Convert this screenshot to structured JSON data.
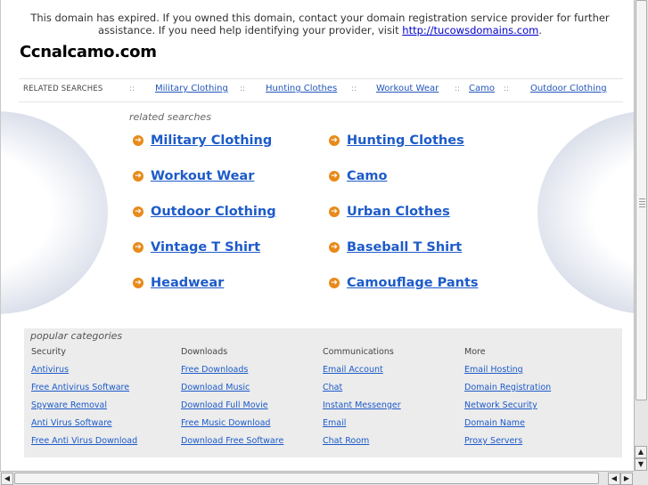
{
  "notice": {
    "text": "This domain has expired. If you owned this domain, contact your domain registration service provider for further assistance. If you need help identifying your provider, visit ",
    "link": "http://tucowsdomains.com",
    "suffix": "."
  },
  "site": {
    "title": "Ccnalcamo.com"
  },
  "related_bar": {
    "label": "RELATED SEARCHES",
    "separator": "::",
    "links": [
      "Military Clothing",
      "Hunting Clothes",
      "Workout Wear",
      "Camo",
      "Outdoor Clothing"
    ]
  },
  "related_searches": {
    "heading": "related searches",
    "items": [
      "Military Clothing",
      "Hunting Clothes",
      "Workout Wear",
      "Camo",
      "Outdoor Clothing",
      "Urban Clothes",
      "Vintage T Shirt",
      "Baseball T Shirt",
      "Headwear",
      "Camouflage Pants"
    ]
  },
  "popular": {
    "heading": "popular categories",
    "columns": [
      {
        "title": "Security",
        "links": [
          "Antivirus",
          "Free Antivirus Software",
          "Spyware Removal",
          "Anti Virus Software",
          "Free Anti Virus Download"
        ]
      },
      {
        "title": "Downloads",
        "links": [
          "Free Downloads",
          "Download Music",
          "Download Full Movie",
          "Free Music Download",
          "Download Free Software"
        ]
      },
      {
        "title": "Communications",
        "links": [
          "Email Account",
          "Chat",
          "Instant Messenger",
          "Email",
          "Chat Room"
        ]
      },
      {
        "title": "More",
        "links": [
          "Email Hosting",
          "Domain Registration",
          "Network Security",
          "Domain Name",
          "Proxy Servers"
        ]
      }
    ]
  },
  "icons": {
    "arrow": "arrow-circle-right-icon"
  },
  "colors": {
    "link": "#1d5bc9",
    "arrow": "#e88a1a",
    "popular_bg": "#ececec"
  }
}
